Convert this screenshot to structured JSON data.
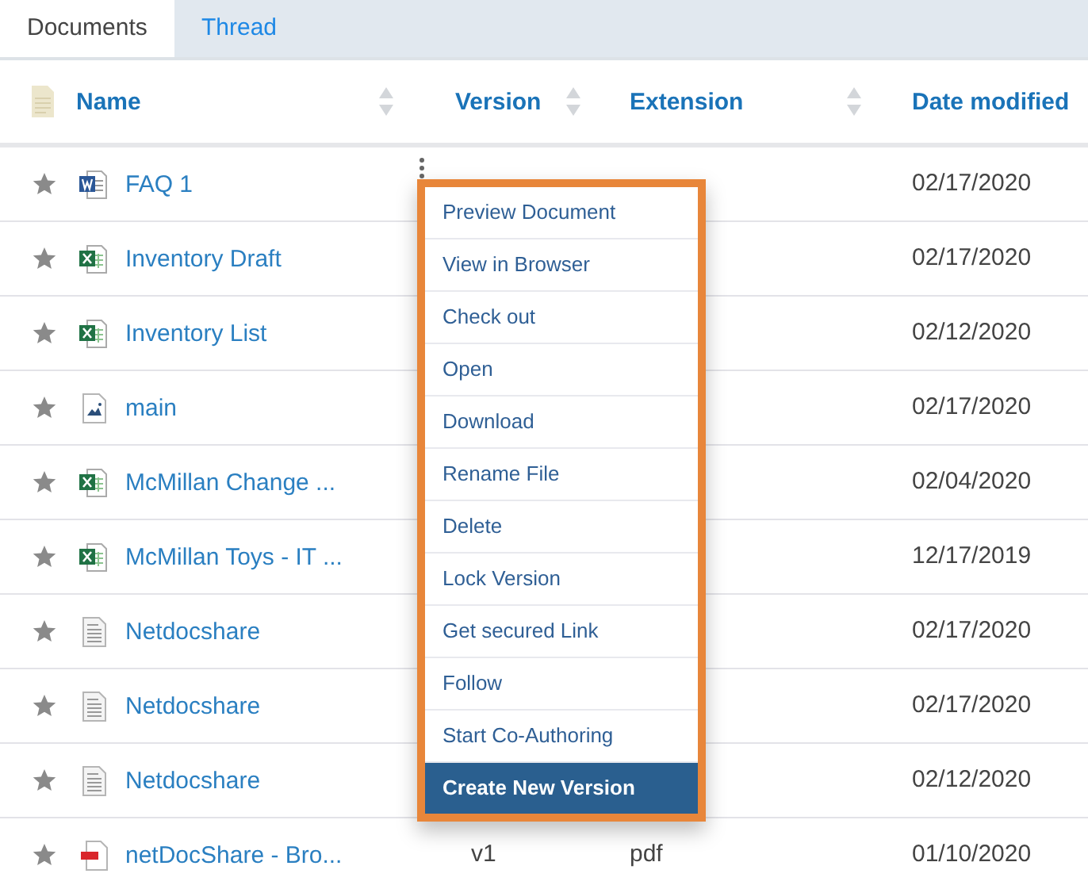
{
  "tabs": [
    {
      "label": "Documents",
      "selected": true
    },
    {
      "label": "Thread",
      "selected": false
    }
  ],
  "table": {
    "columns": [
      {
        "label": "Name",
        "sortable": true
      },
      {
        "label": "Version",
        "sortable": true
      },
      {
        "label": "Extension",
        "sortable": true
      },
      {
        "label": "Date modified",
        "sortable": false
      }
    ],
    "rows": [
      {
        "name": "FAQ 1",
        "kind": "word",
        "date": "02/17/2020",
        "actions_open": true
      },
      {
        "name": "Inventory Draft",
        "kind": "excel",
        "date": "02/17/2020",
        "actions_open": false
      },
      {
        "name": "Inventory List",
        "kind": "excel",
        "date": "02/12/2020",
        "actions_open": false
      },
      {
        "name": "main",
        "kind": "image",
        "date": "02/17/2020",
        "actions_open": false
      },
      {
        "name": "McMillan Change ...",
        "kind": "excel",
        "date": "02/04/2020",
        "actions_open": false
      },
      {
        "name": "McMillan Toys - IT ...",
        "kind": "excel",
        "date": "12/17/2019",
        "actions_open": false
      },
      {
        "name": "Netdocshare",
        "kind": "text",
        "date": "02/17/2020",
        "actions_open": false
      },
      {
        "name": "Netdocshare",
        "kind": "text",
        "date": "02/17/2020",
        "actions_open": false
      },
      {
        "name": "Netdocshare",
        "kind": "text",
        "date": "02/12/2020",
        "actions_open": false
      },
      {
        "name": "netDocShare - Bro...",
        "kind": "pdf",
        "version": "v1",
        "extension": "pdf",
        "date": "01/10/2020",
        "actions_open": false
      }
    ]
  },
  "context_menu": {
    "items": [
      {
        "label": "Preview Document",
        "selected": false
      },
      {
        "label": "View in Browser",
        "selected": false
      },
      {
        "label": "Check out",
        "selected": false
      },
      {
        "label": "Open",
        "selected": false
      },
      {
        "label": "Download",
        "selected": false
      },
      {
        "label": "Rename File",
        "selected": false
      },
      {
        "label": "Delete",
        "selected": false
      },
      {
        "label": "Lock Version",
        "selected": false
      },
      {
        "label": "Get secured Link",
        "selected": false
      },
      {
        "label": "Follow",
        "selected": false
      },
      {
        "label": "Start Co-Authoring",
        "selected": false
      },
      {
        "label": "Create New Version",
        "selected": true
      }
    ]
  }
}
